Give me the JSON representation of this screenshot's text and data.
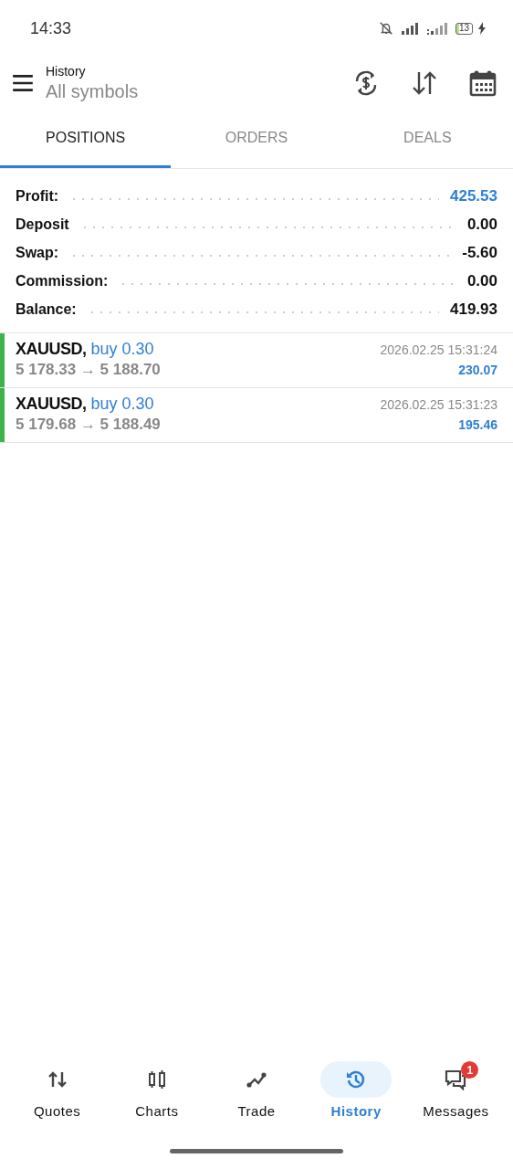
{
  "status_bar": {
    "time": "14:33",
    "battery": "13"
  },
  "header": {
    "title": "History",
    "subtitle": "All symbols"
  },
  "tabs": [
    {
      "label": "POSITIONS",
      "selected": true
    },
    {
      "label": "ORDERS",
      "selected": false
    },
    {
      "label": "DEALS",
      "selected": false
    }
  ],
  "summary": [
    {
      "label": "Profit:",
      "value": "425.53",
      "highlighted": true
    },
    {
      "label": "Deposit",
      "value": "0.00",
      "highlighted": false
    },
    {
      "label": "Swap:",
      "value": "-5.60",
      "highlighted": false
    },
    {
      "label": "Commission:",
      "value": "0.00",
      "highlighted": false
    },
    {
      "label": "Balance:",
      "value": "419.93",
      "highlighted": false
    }
  ],
  "positions": [
    {
      "symbol": "XAUUSD,",
      "side": "buy 0.30",
      "prices": "5 178.33 → 5 188.70",
      "time": "2026.02.25 15:31:24",
      "profit": "230.07",
      "color": "#3cb44b"
    },
    {
      "symbol": "XAUUSD,",
      "side": "buy 0.30",
      "prices": "5 179.68 → 5 188.49",
      "time": "2026.02.25 15:31:23",
      "profit": "195.46",
      "color": "#3cb44b"
    }
  ],
  "nav": [
    {
      "kind": "quotes",
      "label": "Quotes",
      "selected": false
    },
    {
      "kind": "charts",
      "label": "Charts",
      "selected": false
    },
    {
      "kind": "trade",
      "label": "Trade",
      "selected": false
    },
    {
      "kind": "history",
      "label": "History",
      "selected": true
    },
    {
      "kind": "messages",
      "label": "Messages",
      "selected": false,
      "badge": "1"
    }
  ]
}
